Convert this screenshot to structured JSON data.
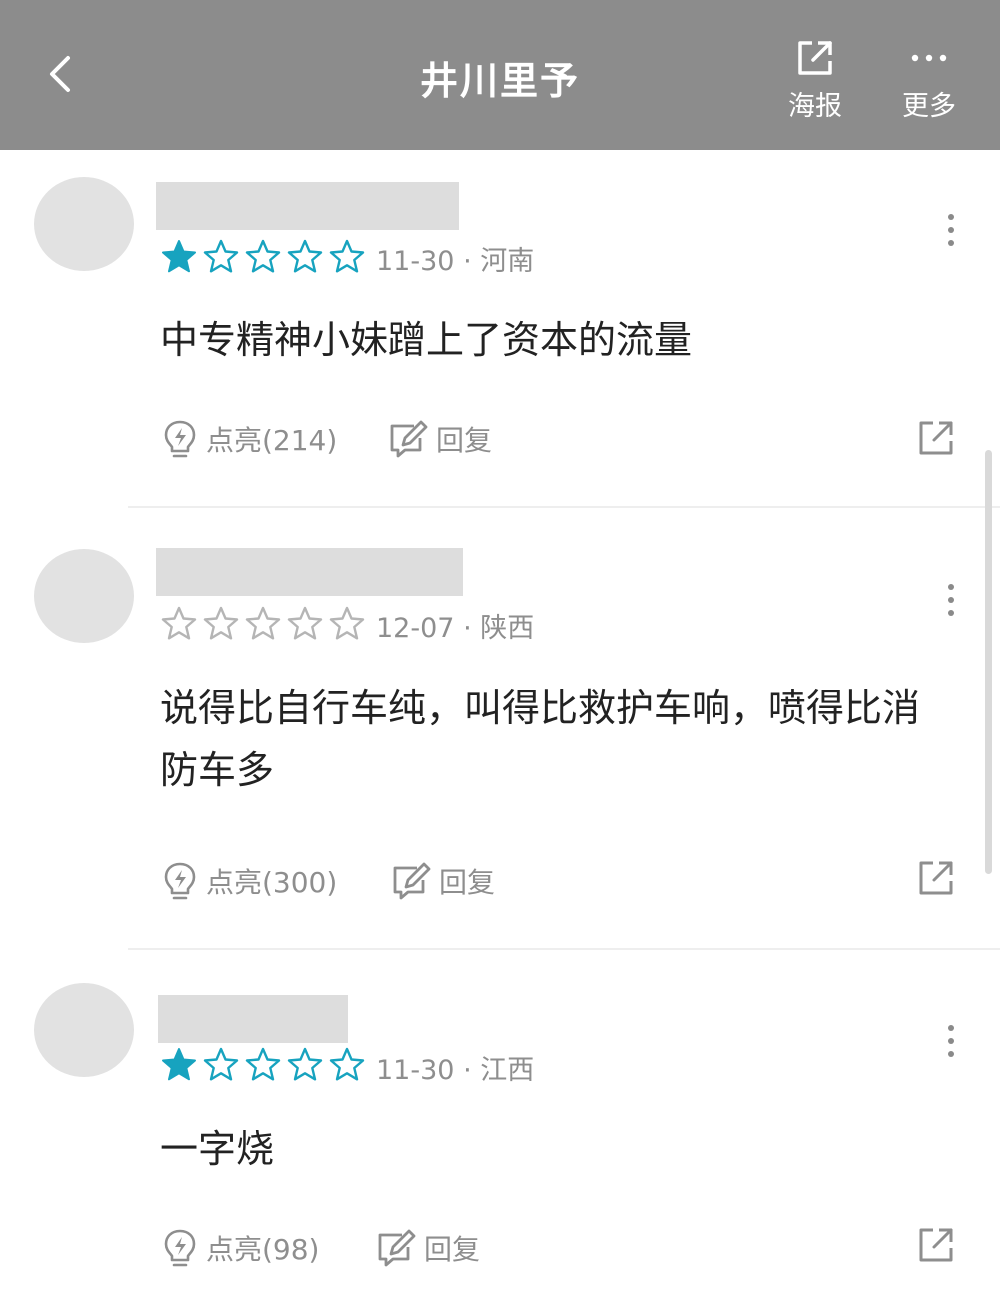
{
  "header": {
    "title": "井川里予",
    "poster_label": "海报",
    "more_label": "更多"
  },
  "colors": {
    "header_bg": "#8c8c8c",
    "star_filled": "#17a3bf",
    "star_empty": "#b5b5b5",
    "meta_text": "#8e8e8e"
  },
  "comments": [
    {
      "rating": 1,
      "date": "11-30",
      "location": "河南",
      "text": "中专精神小妹蹭上了资本的流量",
      "like_label": "点亮(214)",
      "reply_label": "回复"
    },
    {
      "rating": 0,
      "date": "12-07",
      "location": "陕西",
      "text": "说得比自行车纯，叫得比救护车响，喷得比消防车多",
      "like_label": "点亮(300)",
      "reply_label": "回复"
    },
    {
      "rating": 1,
      "date": "11-30",
      "location": "江西",
      "text": "一字烧",
      "like_label": "点亮(98)",
      "reply_label": "回复"
    }
  ]
}
